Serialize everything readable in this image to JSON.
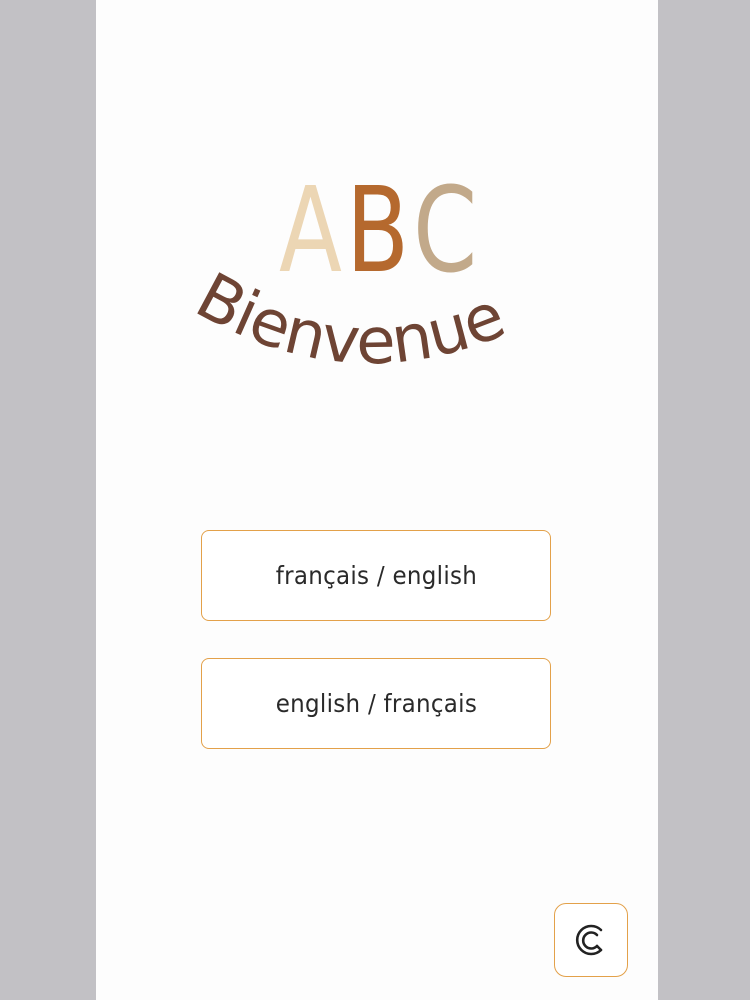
{
  "logo": {
    "letters": [
      {
        "char": "A",
        "color": "#ecd6b4"
      },
      {
        "char": "B",
        "color": "#b5692e"
      },
      {
        "char": "C",
        "color": "#c2a98a"
      }
    ],
    "welcome_text": "Bienvenue",
    "welcome_color": "#6e4434"
  },
  "buttons": {
    "french_english": "français / english",
    "english_french": "english / français"
  },
  "credits_button": {
    "icon": "copyright-c-icon",
    "accent_color": "#e3a14a"
  }
}
